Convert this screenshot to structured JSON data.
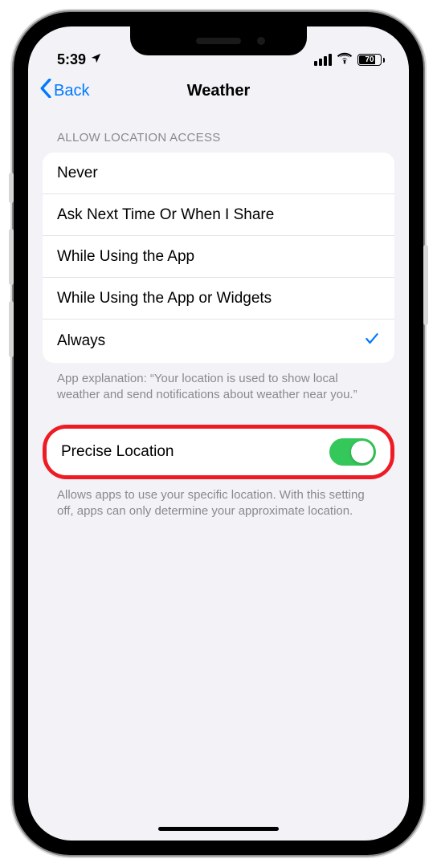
{
  "status": {
    "time": "5:39",
    "battery_text": "70"
  },
  "nav": {
    "back_label": "Back",
    "title": "Weather"
  },
  "section1": {
    "header": "ALLOW LOCATION ACCESS",
    "options": [
      {
        "label": "Never",
        "selected": false
      },
      {
        "label": "Ask Next Time Or When I Share",
        "selected": false
      },
      {
        "label": "While Using the App",
        "selected": false
      },
      {
        "label": "While Using the App or Widgets",
        "selected": false
      },
      {
        "label": "Always",
        "selected": true
      }
    ],
    "footer": "App explanation: “Your location is used to show local weather and send notifications about weather near you.”"
  },
  "section2": {
    "row_label": "Precise Location",
    "toggle_on": true,
    "footer": "Allows apps to use your specific location. With this setting off, apps can only determine your approximate location."
  }
}
